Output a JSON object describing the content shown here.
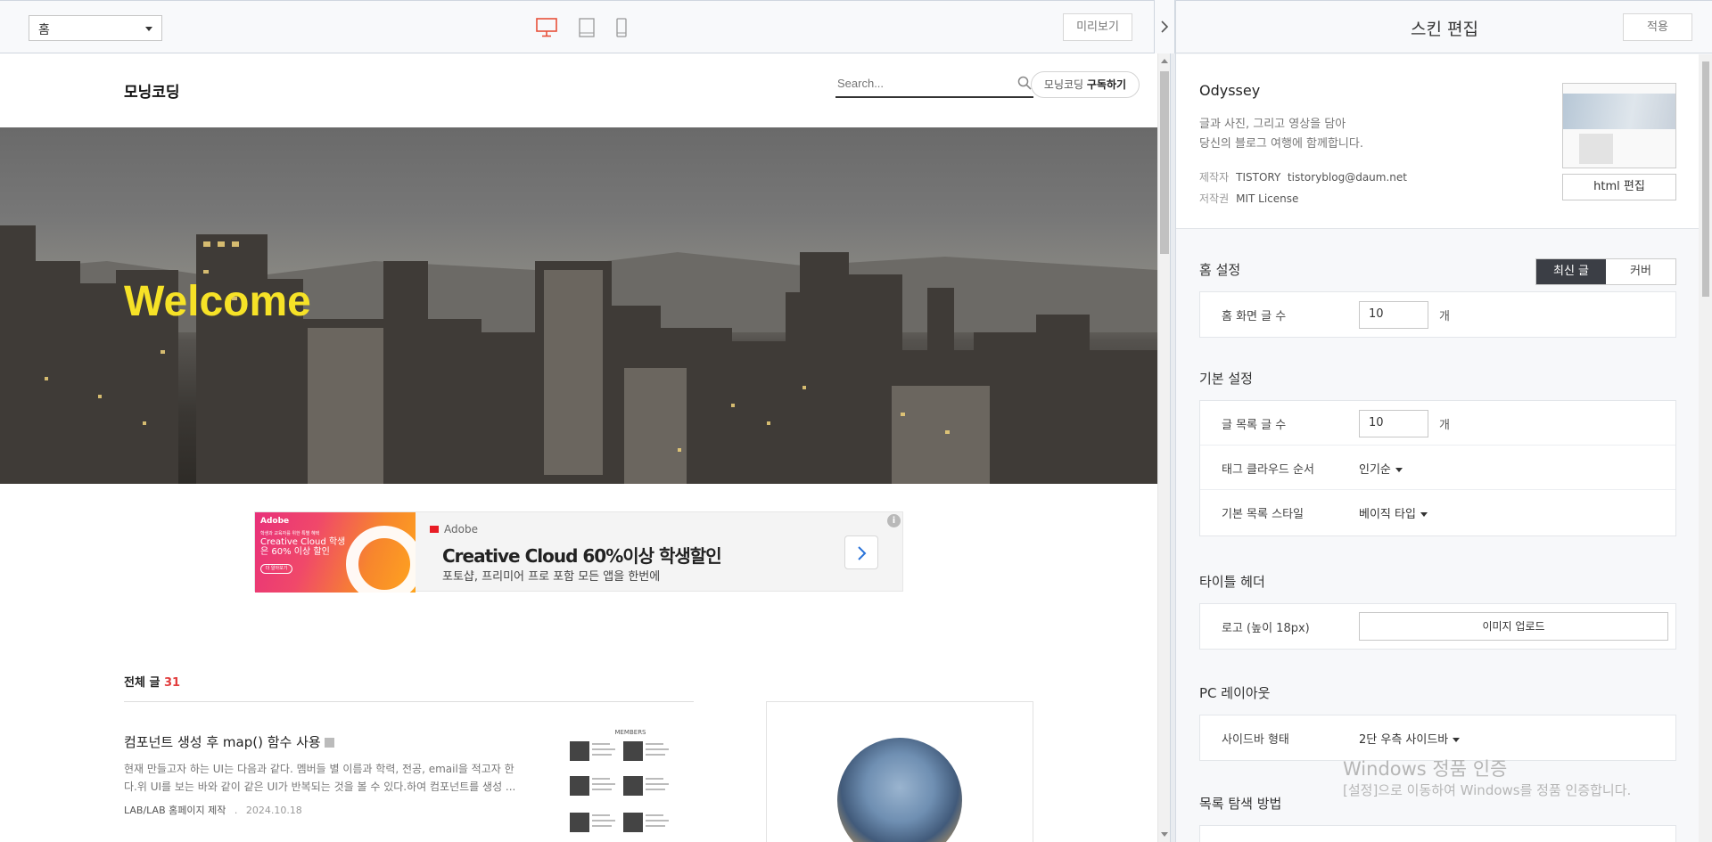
{
  "toolbar": {
    "page_select": "홈",
    "preview_label": "미리보기",
    "active_device": "desktop"
  },
  "blog": {
    "title": "모닝코딩",
    "search_placeholder": "Search...",
    "subscribe_prefix": "모닝코딩",
    "subscribe_label": "구독하기",
    "hero_text": "Welcome",
    "ad": {
      "thumb_brand": "Adobe",
      "thumb_line1": "학생과 교육자를 위한 특별 혜택",
      "thumb_line2": "Creative Cloud 학생은 60% 이상 할인",
      "thumb_button": "더 알아보기",
      "brand": "Adobe",
      "headline": "Creative Cloud 60%이상 학생할인",
      "subline": "포토샵, 프리미어 프로 포함 모든 앱을 한번에",
      "info": "i"
    },
    "posts_header_label": "전체 글",
    "posts_count": "31",
    "post": {
      "title": "컴포넌트 생성 후 map() 함수 사용",
      "excerpt": "현재 만들고자 하는 UI는 다음과 같다. 멤버들 별 이름과 학력, 전공, email을 적고자 한다.위 UI를 보는 바와 같이 같은 UI가 반복되는 것을 볼 수 있다.하여 컴포넌트를 생성 ...",
      "category": "LAB/LAB 홈페이지 제작",
      "separator": ".",
      "date": "2024.10.18",
      "thumb_caption": "MEMBERS"
    }
  },
  "panel": {
    "title": "스킨 편집",
    "apply_label": "적용",
    "skin": {
      "name": "Odyssey",
      "desc1": "글과 사진, 그리고 영상을 담아",
      "desc2": "당신의 블로그 여행에 함께합니다.",
      "author_label": "제작자",
      "author_value": "TISTORY  tistoryblog@daum.net",
      "license_label": "저작권",
      "license_value": "MIT License",
      "html_edit_label": "html 편집"
    },
    "home_settings": {
      "title": "홈 설정",
      "seg_latest": "최신 글",
      "seg_cover": "커버",
      "rows": [
        {
          "label": "홈 화면 글 수",
          "value": "10",
          "unit": "개"
        }
      ]
    },
    "basic_settings": {
      "title": "기본 설정",
      "post_count_label": "글 목록 글 수",
      "post_count_value": "10",
      "post_count_unit": "개",
      "tag_order_label": "태그 클라우드 순서",
      "tag_order_value": "인기순",
      "list_style_label": "기본 목록 스타일",
      "list_style_value": "베이직 타입"
    },
    "title_header": {
      "title": "타이틀 헤더",
      "logo_label": "로고 (높이 18px)",
      "upload_label": "이미지 업로드"
    },
    "pc_layout": {
      "title": "PC 레이아웃",
      "sidebar_label": "사이드바 형태",
      "sidebar_value": "2단 우측 사이드바"
    },
    "list_nav": {
      "title": "목록 탐색 방법"
    }
  },
  "watermark": {
    "line1": "Windows 정품 인증",
    "line2": "[설정]으로 이동하여 Windows를 정품 인증합니다."
  },
  "colors": {
    "hero_text": "#f6e227",
    "accent_red": "#e23e3e",
    "device_active": "#e8503a",
    "segment_active": "#3b3e45"
  }
}
